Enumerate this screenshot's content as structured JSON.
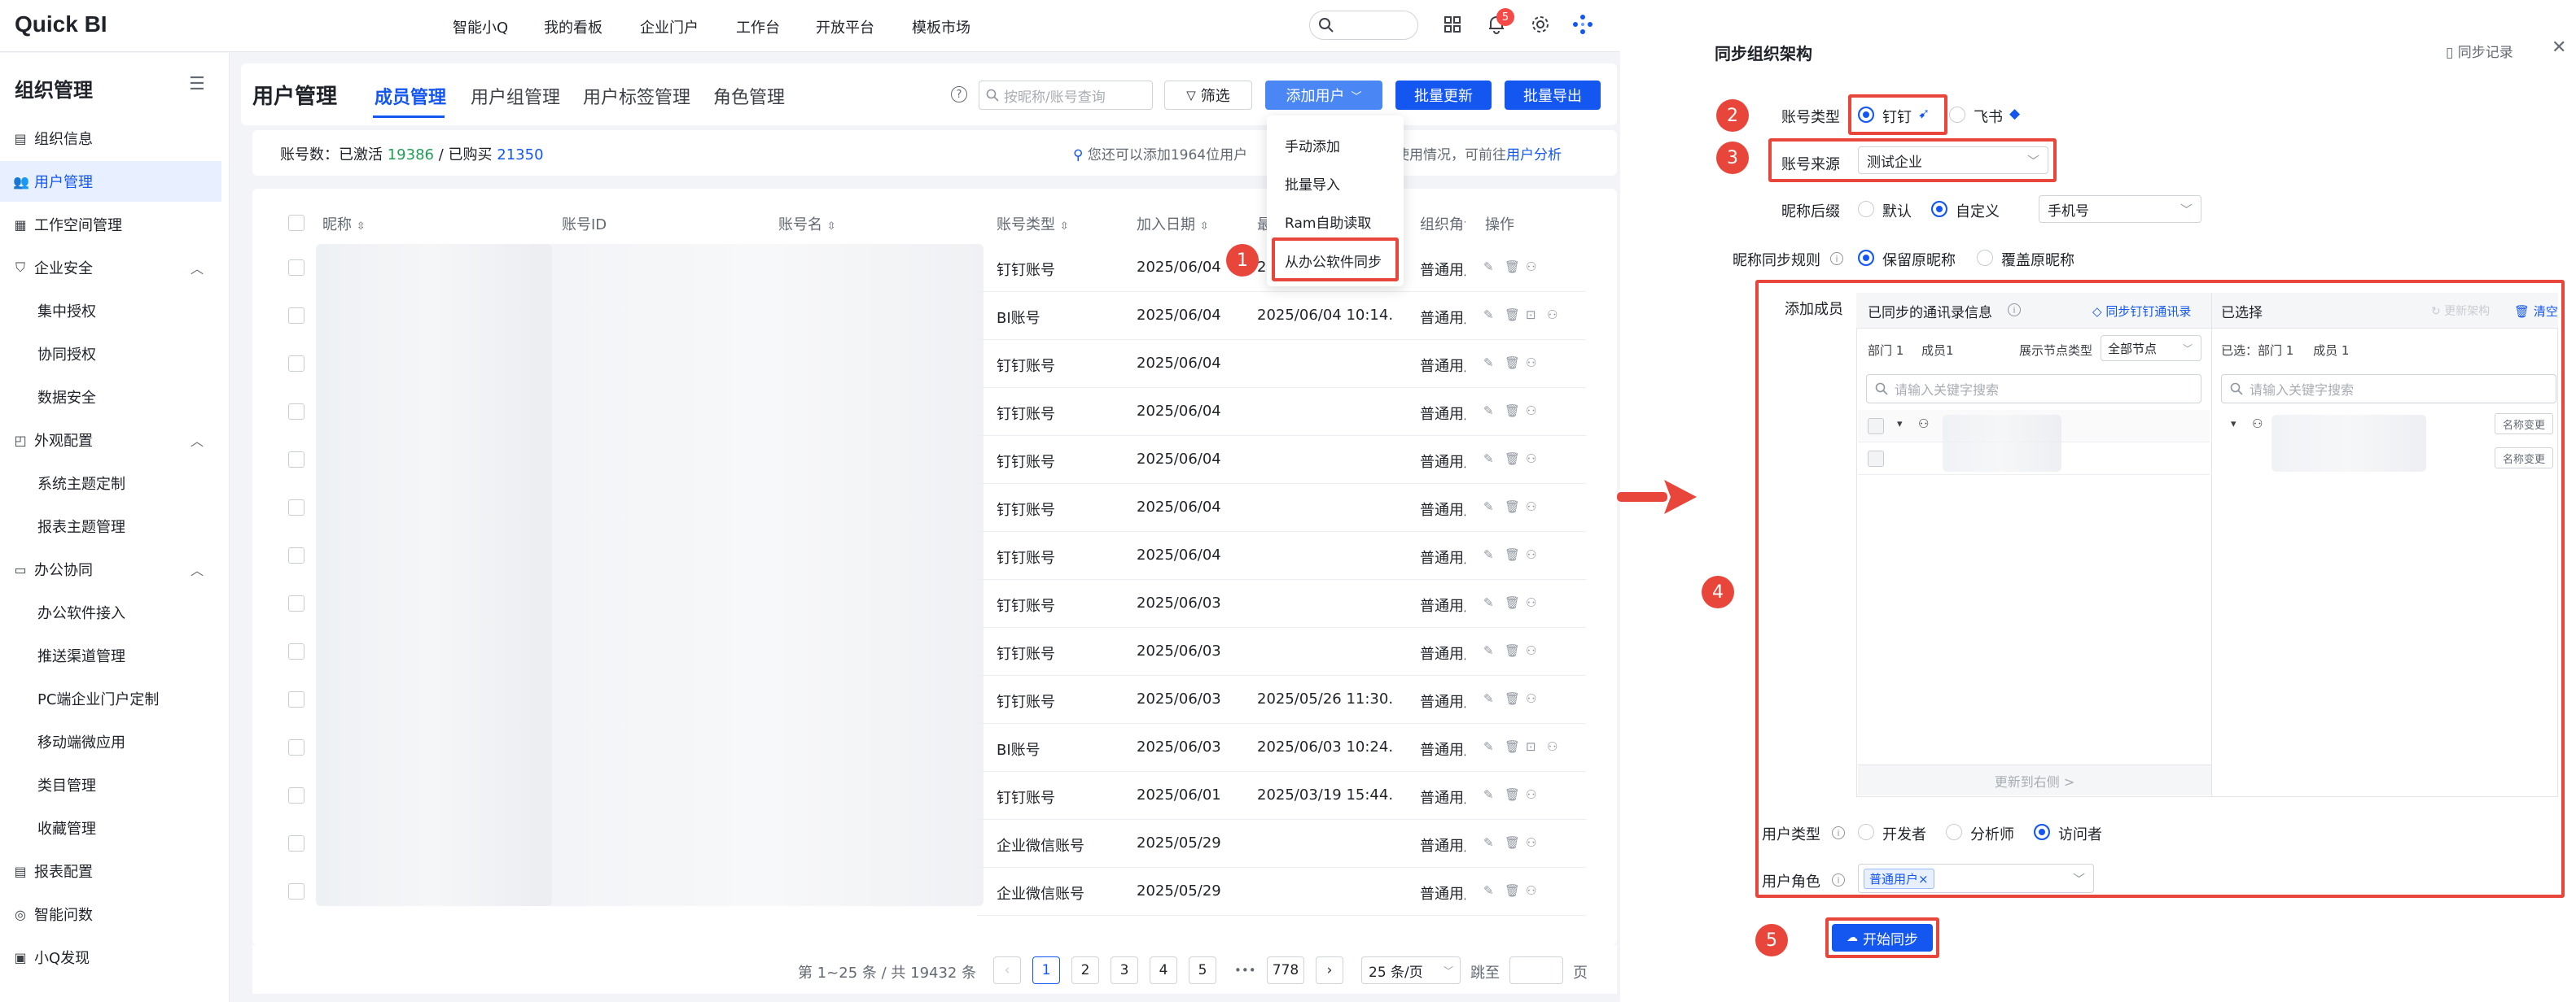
{
  "app": {
    "logo": "Quick BI"
  },
  "topnav": {
    "items": [
      "智能小Q",
      "我的看板",
      "企业门户",
      "工作台",
      "开放平台",
      "模板市场"
    ],
    "notification_count": "5",
    "icons": [
      "search-icon",
      "grid-icon",
      "bell-icon",
      "gear-icon",
      "dots-icon"
    ]
  },
  "sidebar": {
    "title": "组织管理",
    "items": [
      {
        "label": "组织信息",
        "icon": "org-icon"
      },
      {
        "label": "用户管理",
        "icon": "users-icon",
        "active": true
      },
      {
        "label": "工作空间管理",
        "icon": "workspace-icon"
      },
      {
        "label": "企业安全",
        "icon": "shield-icon",
        "expanded": true
      },
      {
        "label": "集中授权",
        "sub": true
      },
      {
        "label": "协同授权",
        "sub": true
      },
      {
        "label": "数据安全",
        "sub": true
      },
      {
        "label": "外观配置",
        "icon": "palette-icon",
        "expanded": true
      },
      {
        "label": "系统主题定制",
        "sub": true
      },
      {
        "label": "报表主题管理",
        "sub": true
      },
      {
        "label": "办公协同",
        "icon": "office-icon",
        "expanded": true
      },
      {
        "label": "办公软件接入",
        "sub": true
      },
      {
        "label": "推送渠道管理",
        "sub": true
      },
      {
        "label": "PC端企业门户定制",
        "sub": true
      },
      {
        "label": "移动端微应用",
        "sub": true
      },
      {
        "label": "类目管理",
        "sub": true
      },
      {
        "label": "收藏管理",
        "sub": true
      },
      {
        "label": "报表配置",
        "icon": "report-icon"
      },
      {
        "label": "智能问数",
        "icon": "ai-icon"
      },
      {
        "label": "小Q发现",
        "icon": "discover-icon"
      }
    ]
  },
  "main": {
    "title": "用户管理",
    "tabs": [
      "成员管理",
      "用户组管理",
      "用户标签管理",
      "角色管理"
    ],
    "search_placeholder": "按昵称/账号查询",
    "filter_label": "筛选",
    "add_user_label": "添加用户",
    "batch_update_label": "批量更新",
    "batch_export_label": "批量导出",
    "count_text": "账号数：已激活",
    "activated": "19386",
    "separator": "/ 已购买",
    "purchased": "21350",
    "hint_text": "您还可以添加1964位用户",
    "hint_tail": "使用情况，可前往",
    "hint_link": "用户分析"
  },
  "dropdown": {
    "items": [
      "手动添加",
      "批量导入",
      "Ram自助读取",
      "从办公软件同步"
    ]
  },
  "table": {
    "columns": [
      "昵称",
      "账号ID",
      "账号名",
      "账号类型",
      "加入日期",
      "最",
      "组织角色",
      "操作"
    ],
    "rows": [
      {
        "type": "钉钉账号",
        "date": "2025/06/04",
        "last": "2",
        "role": "普通用户"
      },
      {
        "type": "BI账号",
        "date": "2025/06/04",
        "last": "2025/06/04 10:14...",
        "role": "普通用户"
      },
      {
        "type": "钉钉账号",
        "date": "2025/06/04",
        "last": "",
        "role": "普通用户"
      },
      {
        "type": "钉钉账号",
        "date": "2025/06/04",
        "last": "",
        "role": "普通用户"
      },
      {
        "type": "钉钉账号",
        "date": "2025/06/04",
        "last": "",
        "role": "普通用户"
      },
      {
        "type": "钉钉账号",
        "date": "2025/06/04",
        "last": "",
        "role": "普通用户"
      },
      {
        "type": "钉钉账号",
        "date": "2025/06/04",
        "last": "",
        "role": "普通用户"
      },
      {
        "type": "钉钉账号",
        "date": "2025/06/03",
        "last": "",
        "role": "普通用户"
      },
      {
        "type": "钉钉账号",
        "date": "2025/06/03",
        "last": "",
        "role": "普通用户"
      },
      {
        "type": "钉钉账号",
        "date": "2025/06/03",
        "last": "2025/05/26 11:30...",
        "role": "普通用户"
      },
      {
        "type": "BI账号",
        "date": "2025/06/03",
        "last": "2025/06/03 10:24...",
        "role": "普通用户"
      },
      {
        "type": "钉钉账号",
        "date": "2025/06/01",
        "last": "2025/03/19 15:44...",
        "role": "普通用户"
      },
      {
        "type": "企业微信账号",
        "date": "2025/05/29",
        "last": "",
        "role": "普通用户"
      },
      {
        "type": "企业微信账号",
        "date": "2025/05/29",
        "last": "",
        "role": "普通用户"
      }
    ]
  },
  "pagination": {
    "summary": "第 1~25 条 / 共 19432 条",
    "pages": [
      "1",
      "2",
      "3",
      "4",
      "5",
      "•••",
      "778"
    ],
    "page_size": "25 条/页",
    "jump_label": "跳至",
    "page_unit": "页"
  },
  "markers": [
    "1",
    "2",
    "3",
    "4",
    "5"
  ],
  "panel": {
    "title": "同步组织架构",
    "sync_record": "同步记录",
    "account_type_label": "账号类型",
    "account_types": [
      "钉钉",
      "飞书"
    ],
    "account_source_label": "账号来源",
    "account_source_value": "测试企业",
    "nickname_suffix_label": "昵称后缀",
    "suffix_options": [
      "默认",
      "自定义"
    ],
    "suffix_value": "手机号",
    "nickname_rule_label": "昵称同步规则",
    "rule_options": [
      "保留原昵称",
      "覆盖原昵称"
    ],
    "add_member_label": "添加成员",
    "synced_title": "已同步的通讯录信息",
    "sync_dingtalk_link": "同步钉钉通讯录",
    "dept_count": "部门 1",
    "member_count": "成员1",
    "node_type_label": "展示节点类型",
    "node_type_value": "全部节点",
    "keyword_placeholder": "请输入关键字搜索",
    "update_right": "更新到右侧 >",
    "selected_title": "已选择",
    "update_arch": "更新架构",
    "clear": "清空",
    "selected_summary": "已选：部门 1     成员 1",
    "rename_label": "名称变更",
    "user_type_label": "用户类型",
    "user_types": [
      "开发者",
      "分析师",
      "访问者"
    ],
    "user_role_label": "用户角色",
    "user_role_tag": "普通用户",
    "start_sync": "开始同步"
  },
  "colors": {
    "brand": "#1456f0",
    "annotation": "#e8463a",
    "green": "#1f9d55"
  }
}
